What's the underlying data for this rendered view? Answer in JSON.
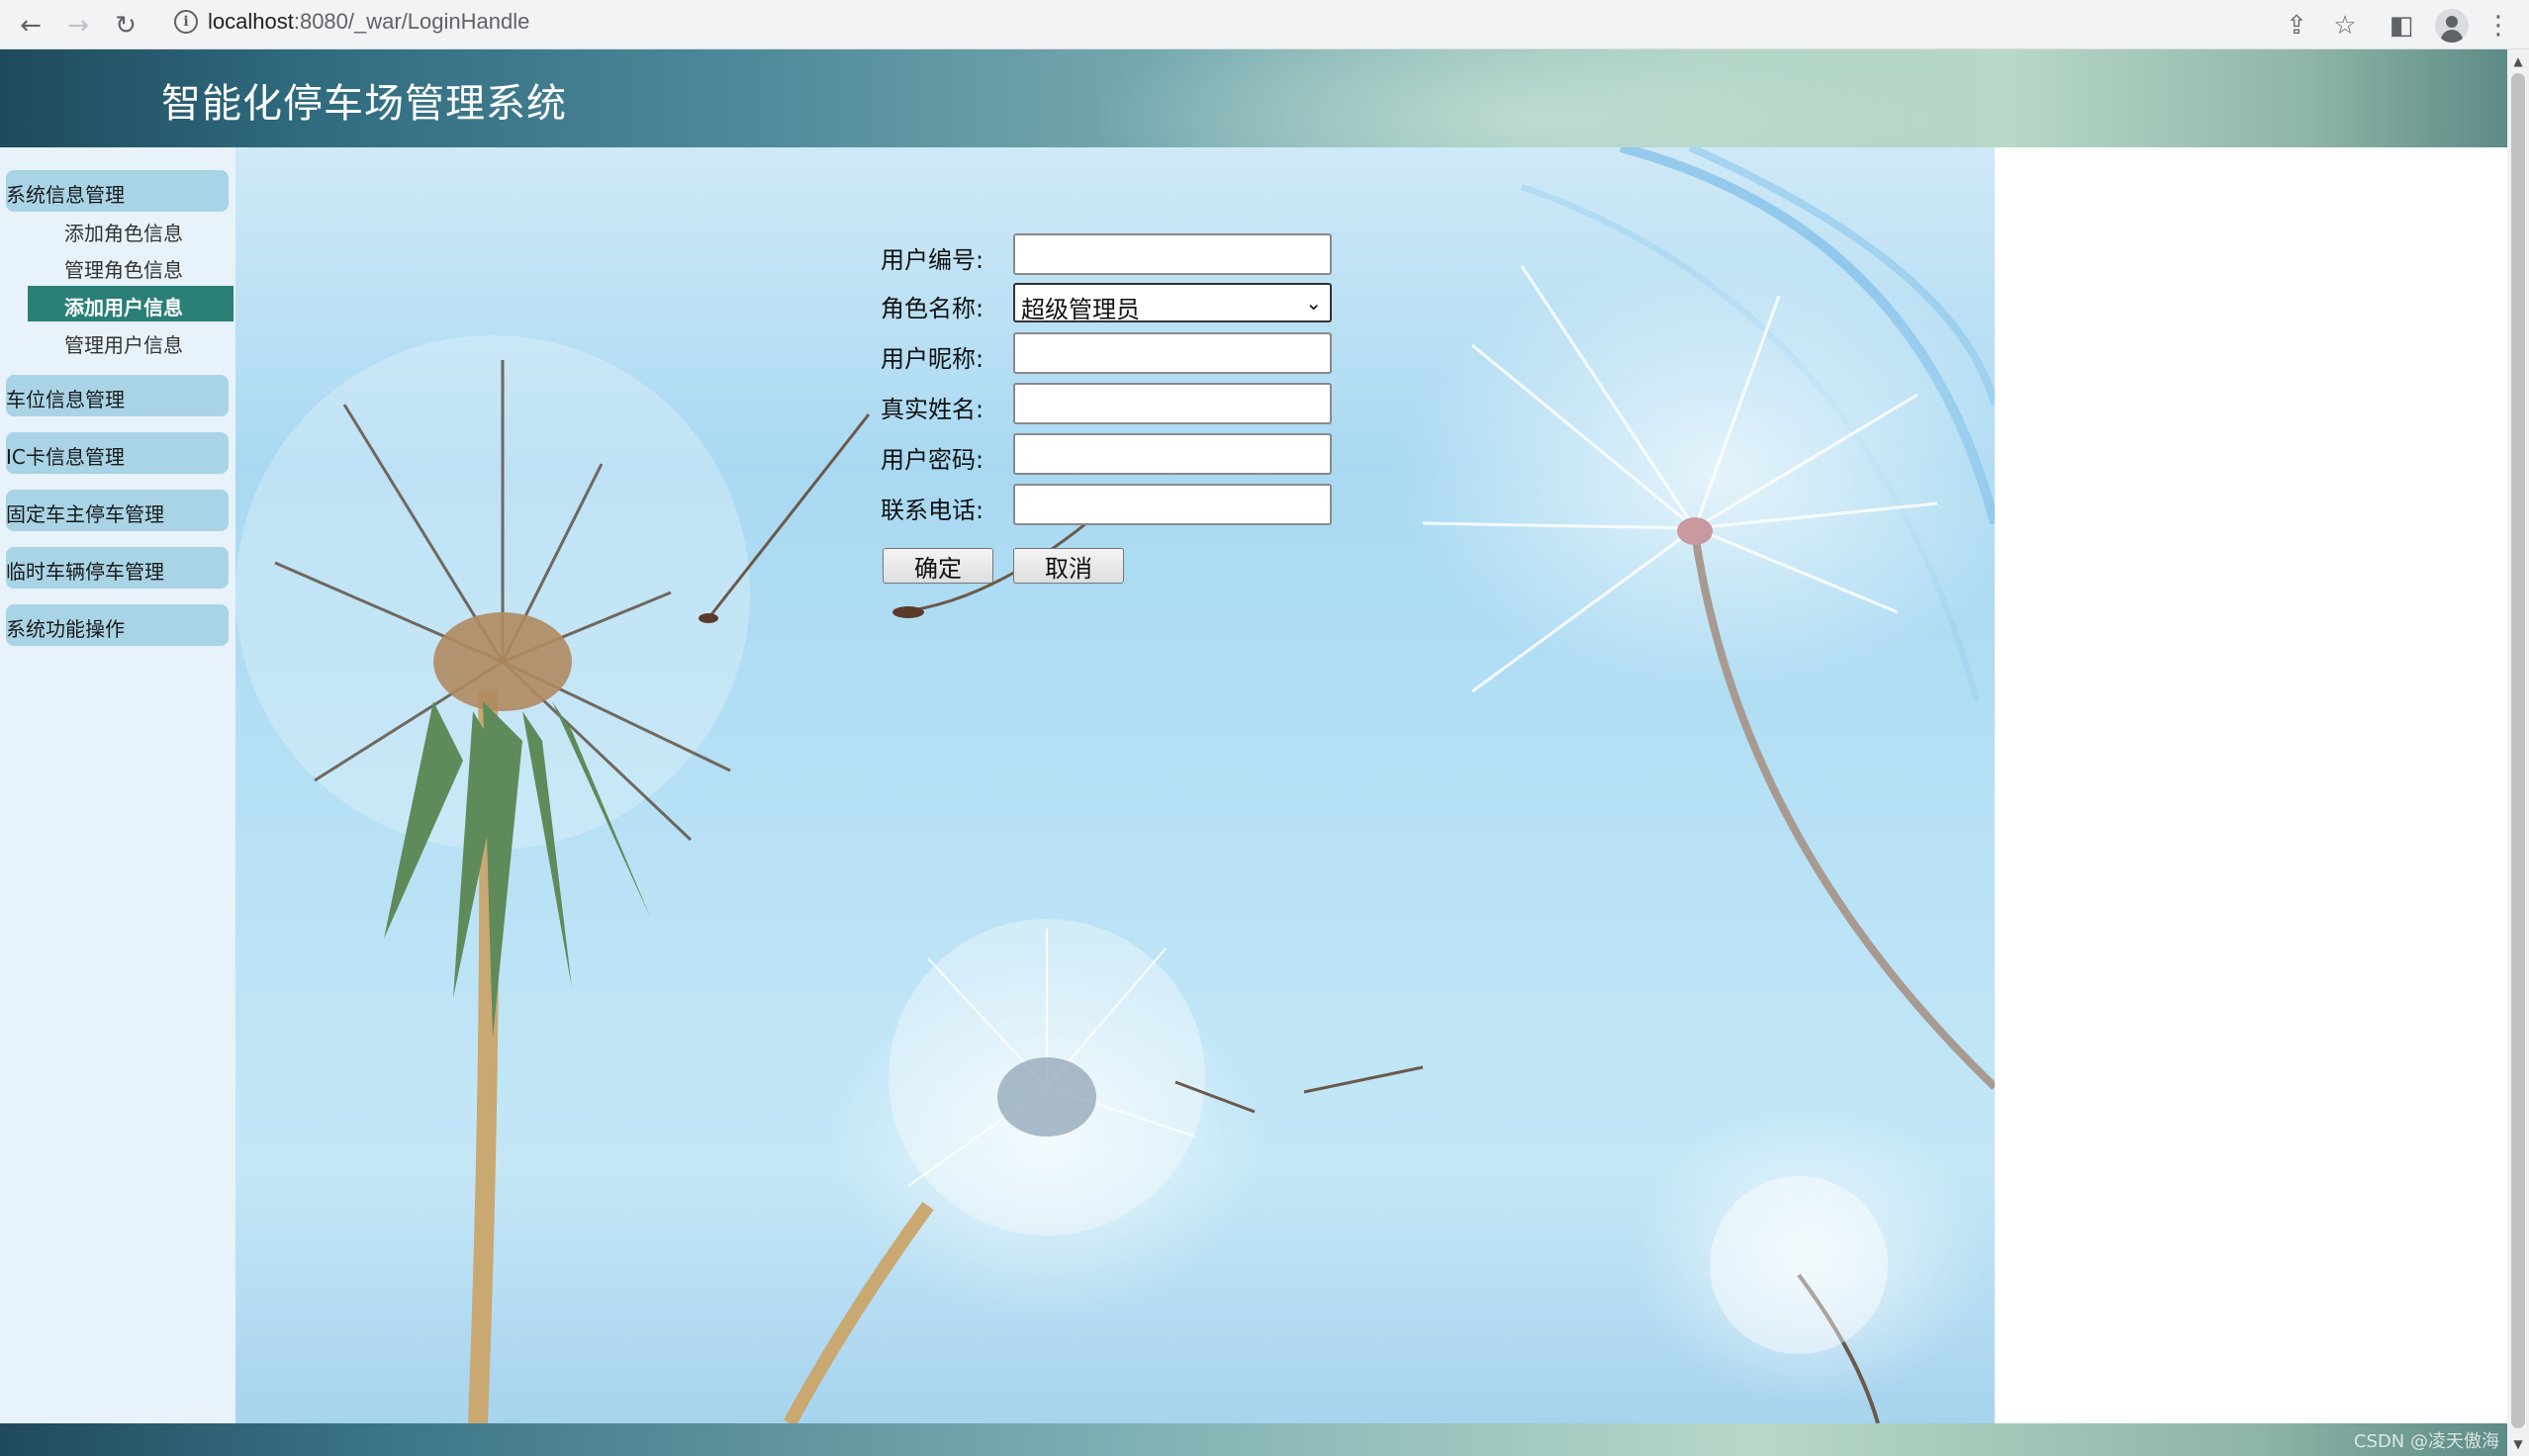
{
  "browser": {
    "url_host": "localhost",
    "url_rest": ":8080/_war/LoginHandle",
    "back_icon": "←",
    "forward_icon": "→",
    "reload_icon": "↻",
    "info_icon": "i",
    "share_icon": "⇪",
    "bookmark_icon": "☆",
    "sidepanel_icon": "◧",
    "menu_icon": "⋮"
  },
  "header": {
    "title": "智能化停车场管理系统"
  },
  "sidebar": {
    "groups": [
      {
        "label": "系统信息管理"
      },
      {
        "label": "车位信息管理"
      },
      {
        "label": "IC卡信息管理"
      },
      {
        "label": "固定车主停车管理"
      },
      {
        "label": "临时车辆停车管理"
      },
      {
        "label": "系统功能操作"
      }
    ],
    "sub_items": [
      {
        "label": "添加角色信息"
      },
      {
        "label": "管理角色信息"
      },
      {
        "label": "添加用户信息",
        "active": true
      },
      {
        "label": "管理用户信息"
      }
    ]
  },
  "form": {
    "user_id_label": "用户编号:",
    "user_id_value": "",
    "role_label": "角色名称:",
    "role_value": "超级管理员",
    "nickname_label": "用户昵称:",
    "nickname_value": "",
    "realname_label": "真实姓名:",
    "realname_value": "",
    "password_label": "用户密码:",
    "password_value": "",
    "phone_label": "联系电话:",
    "phone_value": "",
    "confirm_label": "确定",
    "cancel_label": "取消"
  },
  "footer": {
    "watermark": "CSDN @凌天傲海"
  }
}
